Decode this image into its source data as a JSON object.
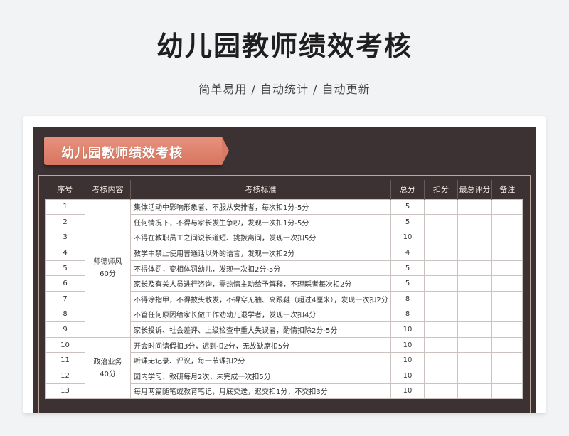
{
  "header": {
    "title": "幼儿园教师绩效考核",
    "subtitle": "简单易用 / 自动统计 / 自动更新"
  },
  "sheet": {
    "banner_title": "幼儿园教师绩效考核",
    "columns": [
      "序号",
      "考核内容",
      "考核标准",
      "总分",
      "扣分",
      "最总评分",
      "备注"
    ],
    "categories": [
      {
        "line1": "师德师风",
        "line2": "60分"
      },
      {
        "line1": "政治业务",
        "line2": "40分"
      }
    ],
    "rows": [
      {
        "no": "1",
        "std": "集体活动中影响形象者、不服从安排者，每次扣1分-5分",
        "total": "5"
      },
      {
        "no": "2",
        "std": "任何情况下，不得与家长发生争吵，发现一次扣1分-5分",
        "total": "5"
      },
      {
        "no": "3",
        "std": "不得在教职员工之间说长道短、挑拨离间，发现一次扣5分",
        "total": "10"
      },
      {
        "no": "4",
        "std": "教学中禁止使用普通话以外的语言，发现一次扣2分",
        "total": "4"
      },
      {
        "no": "5",
        "std": "不得体罚，变相体罚幼儿，发现一次扣2分-5分",
        "total": "5"
      },
      {
        "no": "6",
        "std": "家长及有关人员进行咨询，需热情主动给予解释，不理睬者每次扣2分",
        "total": "5"
      },
      {
        "no": "7",
        "std": "不得涂指甲，不得披头散发，不得穿无袖、高跟鞋（超过4厘米），发现一次扣2分",
        "total": "8"
      },
      {
        "no": "8",
        "std": "不管任何原因给家长做工作劝幼儿退学者，发现一次扣4分",
        "total": "8"
      },
      {
        "no": "9",
        "std": "家长投诉、社会差评、上级检查中重大失误者，酌情扣除2分-5分",
        "total": "10"
      },
      {
        "no": "10",
        "std": "开会时间请假扣3分，迟到扣2分，无故缺席扣5分",
        "total": "10"
      },
      {
        "no": "11",
        "std": "听课无记录、评议，每一节课扣2分",
        "total": "10"
      },
      {
        "no": "12",
        "std": "园内学习、教研每月2次，未完成一次扣5分",
        "total": "10"
      },
      {
        "no": "13",
        "std": "每月两篇随笔或教育笔记，月底交送，迟交扣1分，不交扣3分",
        "total": "10"
      }
    ]
  }
}
